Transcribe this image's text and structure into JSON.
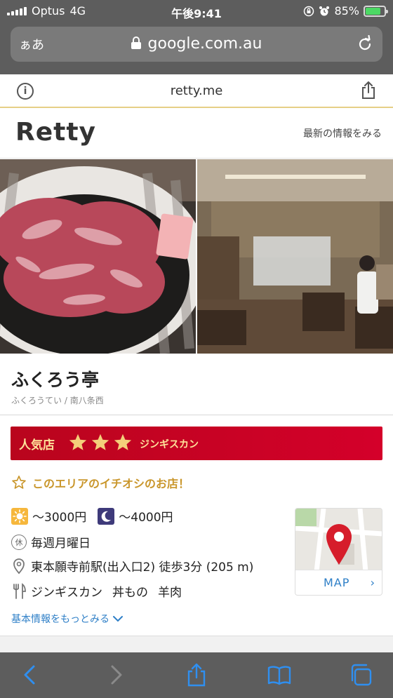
{
  "status_bar": {
    "carrier": "Optus",
    "network": "4G",
    "time": "午後9:41",
    "battery": "85%"
  },
  "browser": {
    "text_size_button": "ぁあ",
    "domain": "google.com.au"
  },
  "site_bar": {
    "domain": "retty.me"
  },
  "header": {
    "logo": "Retty",
    "latest_link": "最新の情報をみる"
  },
  "restaurant": {
    "name": "ふくろう亭",
    "reading": "ふくろうてい",
    "separator": "/",
    "area": "南八条西"
  },
  "banner": {
    "label": "人気店",
    "star_count": 3,
    "genre": "ジンギスカン"
  },
  "area_pick": "このエリアのイチオシのお店！",
  "info": {
    "lunch_price": "〜3000円",
    "dinner_price": "〜4000円",
    "holiday_badge": "休",
    "holiday": "毎週月曜日",
    "access": "東本願寺前駅(出入口2) 徒歩3分 (205 m)",
    "genres": [
      "ジンギスカン",
      "丼もの",
      "羊肉"
    ]
  },
  "more_info": "基本情報をもっとみる",
  "map": {
    "label": "MAP"
  },
  "colors": {
    "banner_red": "#c8001f",
    "star_gold": "#f4cf7a",
    "link_blue": "#2e7fc7",
    "pick_gold": "#c9962b",
    "map_pin_red": "#d61d2b"
  }
}
